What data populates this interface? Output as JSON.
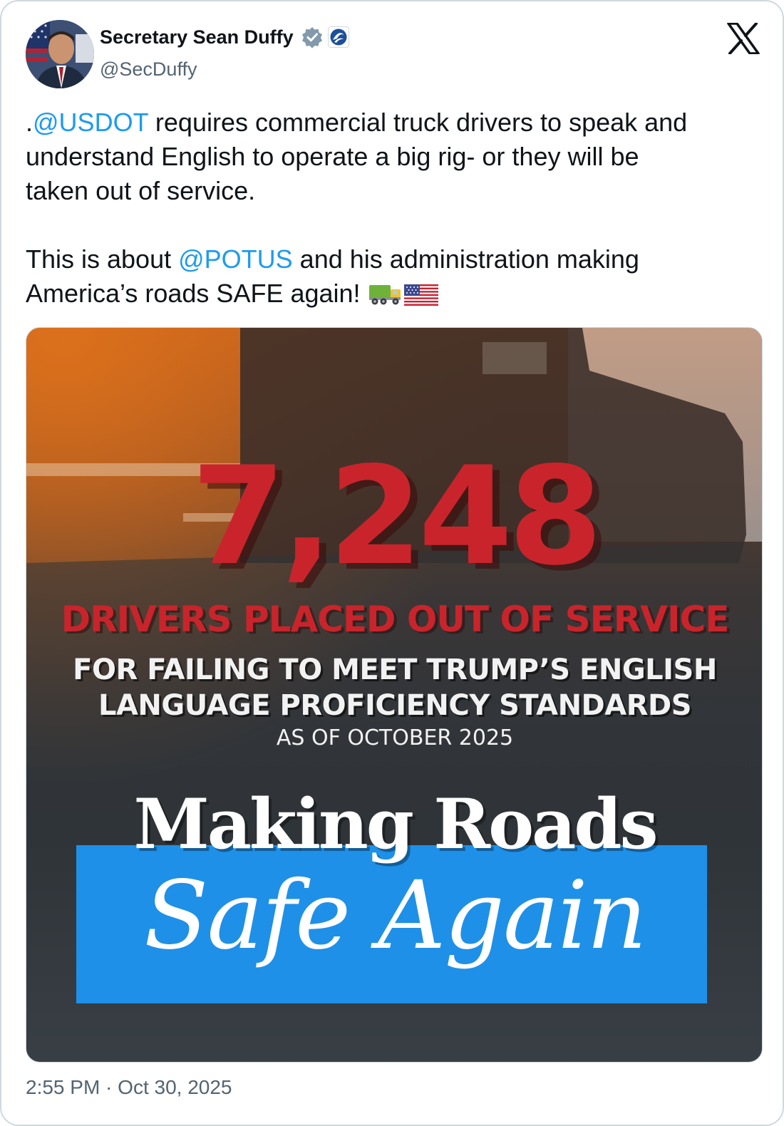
{
  "author": {
    "display_name": "Secretary Sean Duffy",
    "handle": "@SecDuffy",
    "verified_badge_icon": "verified-badge-icon",
    "affiliation_badge_icon": "usdot-logo-icon",
    "avatar_icon": "profile-photo"
  },
  "platform_logo_icon": "x-logo-icon",
  "tweet": {
    "p1_prefix": ".",
    "p1_mention": "@USDOT",
    "p1_line1_rest": " requires commercial truck drivers to speak and",
    "p1_line2": "understand English to operate a big rig- or they will be",
    "p1_line3": "taken out of service.",
    "p2_line1_prefix": "This is about ",
    "p2_mention": "@POTUS",
    "p2_line1_rest": " and his administration making",
    "p2_line2": "America’s roads SAFE again! ",
    "emojis": [
      "truck-emoji",
      "us-flag-emoji"
    ]
  },
  "media": {
    "number": "7,248",
    "headline": "DRIVERS PLACED OUT OF SERVICE",
    "subline1": "FOR FAILING TO MEET TRUMP’S ENGLISH",
    "subline2": "LANGUAGE PROFICIENCY STANDARDS",
    "as_of": "AS OF OCTOBER 2025",
    "slogan_line1": "Making Roads",
    "slogan_line2": "Safe Again",
    "colors": {
      "number_red": "#c9242b",
      "banner_blue": "#1e90e8"
    }
  },
  "timestamp": "2:55 PM · Oct 30, 2025",
  "colors": {
    "link_blue": "#1d9bf0",
    "secondary_text": "#536471"
  }
}
